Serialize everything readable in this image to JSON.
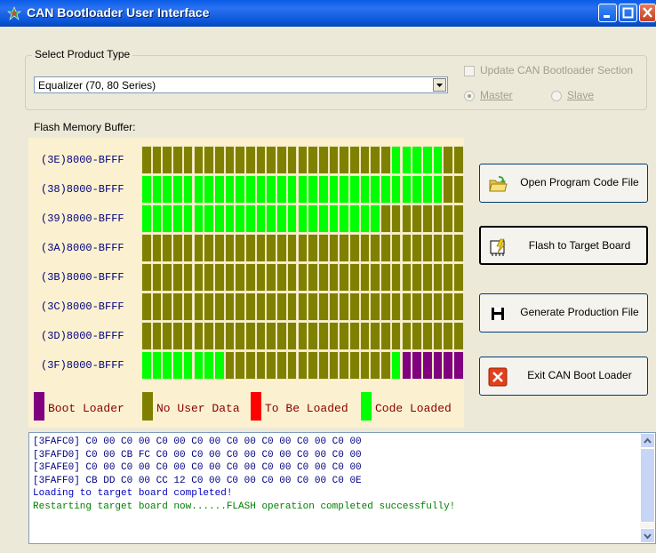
{
  "window": {
    "title": "CAN Bootloader User Interface"
  },
  "product": {
    "group_label": "Select Product Type",
    "selected": "Equalizer (70, 80 Series)",
    "update_section_label": "Update CAN Bootloader Section",
    "update_section_checked": false,
    "master_label": "Master",
    "slave_label": "Slave",
    "selected_role": "Master"
  },
  "flash": {
    "label": "Flash Memory Buffer:",
    "rows": [
      {
        "label": "(3E)8000-BFFF",
        "cells": "NNNNNNNNNNNNNNNNNNNNNNNNNNNNNNNNNNNNNNNNNNNNNNNCCCCCCCCCCCNNNN"
      },
      {
        "label": "(38)8000-BFFF",
        "cells": "CCCCCCCCCCCCCCCCCCCCCCCCCCCCCCCCCCCCCCCCCCCCCCCCCCCCCCCCCNNNNN"
      },
      {
        "label": "(39)8000-BFFF",
        "cells": "CCCCCCCCCCCCCCCCCCCCCCCCCCCCCCCCCCCCCCCCCCCCCNNNNNNNNNNNNNNNNN"
      },
      {
        "label": "(3A)8000-BFFF",
        "cells": "NNNNNNNNNNNNNNNNNNNNNNNNNNNNNNNNNNNNNNNNNNNNNNNNNNNNNNNNNNNNNN"
      },
      {
        "label": "(3B)8000-BFFF",
        "cells": "NNNNNNNNNNNNNNNNNNNNNNNNNNNNNNNNNNNNNNNNNNNNNNNNNNNNNNNNNNNNNN"
      },
      {
        "label": "(3C)8000-BFFF",
        "cells": "NNNNNNNNNNNNNNNNNNNNNNNNNNNNNNNNNNNNNNNNNNNNNNNNNNNNNNNNNNNNNN"
      },
      {
        "label": "(3D)8000-BFFF",
        "cells": "NNNNNNNNNNNNNNNNNNNNNNNNNNNNNNNNNNNNNNNNNNNNNNNNNNNNNNNNNNNNNN"
      },
      {
        "label": "(3F)8000-BFFF",
        "cells": "CCCCCCCCCCCCCCCCNNNNNNNNNNNNNNNNNNNNNNNNNNNNNNNCCBBBBBBBBBBBBB"
      }
    ],
    "legend": [
      {
        "key": "B",
        "label": "Boot Loader",
        "color": "#800080"
      },
      {
        "key": "N",
        "label": "No User Data",
        "color": "#808000"
      },
      {
        "key": "R",
        "label": "To Be Loaded",
        "color": "#ff0000"
      },
      {
        "key": "C",
        "label": "Code Loaded",
        "color": "#00ff00"
      }
    ]
  },
  "buttons": {
    "open": "Open Program Code File",
    "flash": "Flash to Target Board",
    "generate": "Generate Production File",
    "exit": "Exit CAN Boot Loader"
  },
  "log": {
    "lines": [
      {
        "text": "[3FAFC0] C0 00 C0 00 C0 00 C0 00 C0 00 C0 00 C0 00 C0 00",
        "color": "#000080"
      },
      {
        "text": "[3FAFD0] C0 00 CB FC C0 00 C0 00 C0 00 C0 00 C0 00 C0 00",
        "color": "#000080"
      },
      {
        "text": "[3FAFE0] C0 00 C0 00 C0 00 C0 00 C0 00 C0 00 C0 00 C0 00",
        "color": "#000080"
      },
      {
        "text": "[3FAFF0] CB DD C0 00 CC 12 C0 00 C0 00 C0 00 C0 00 C0 0E",
        "color": "#000080"
      },
      {
        "text": "Loading to target board completed!",
        "color": "#0000c0"
      },
      {
        "text": "Restarting target board now......FLASH operation completed successfully!",
        "color": "#008000"
      }
    ]
  }
}
